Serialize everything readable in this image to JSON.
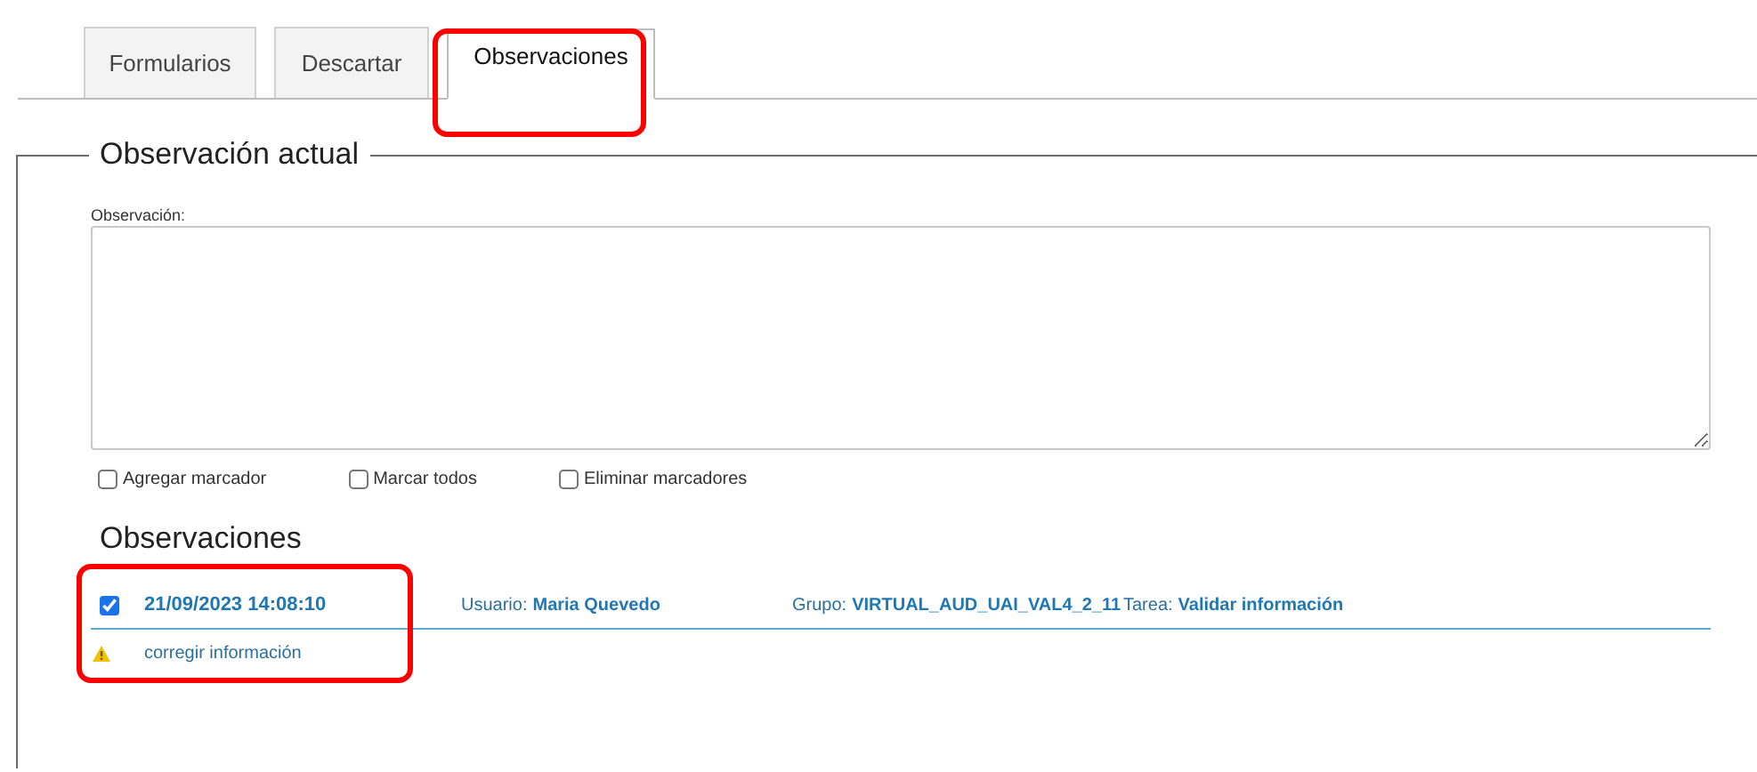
{
  "tabs": [
    {
      "label": "Formularios",
      "selected": false
    },
    {
      "label": "Descartar",
      "selected": false
    },
    {
      "label": "Observaciones",
      "selected": true
    }
  ],
  "current_observation": {
    "legend": "Observación actual",
    "field_label": "Observación:",
    "options": [
      {
        "label": "Agregar marcador",
        "checked": false
      },
      {
        "label": "Marcar todos",
        "checked": false
      },
      {
        "label": "Eliminar marcadores",
        "checked": false
      }
    ]
  },
  "observations": {
    "heading": "Observaciones",
    "items": [
      {
        "checked": true,
        "date": "21/09/2023 14:08:10",
        "fields": [
          {
            "label": "Usuario:",
            "value": "Maria Quevedo"
          },
          {
            "label": "Grupo:",
            "value": "VIRTUAL_AUD_UAI_VAL4_2_11"
          },
          {
            "label": "Tarea:",
            "value": "Validar información"
          }
        ],
        "note": "corregir información"
      }
    ]
  }
}
